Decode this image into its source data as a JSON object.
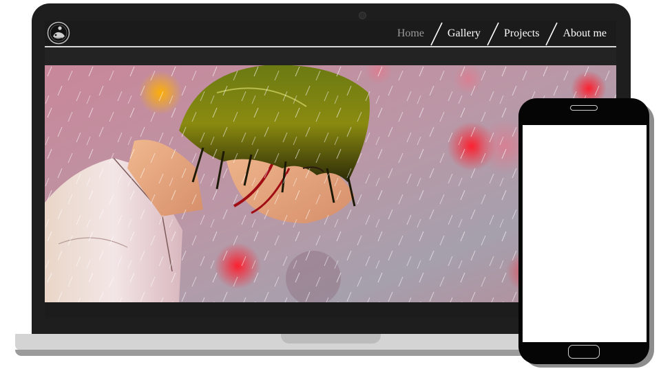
{
  "site": {
    "nav": [
      {
        "label": "Home",
        "active": true
      },
      {
        "label": "Gallery",
        "active": false
      },
      {
        "label": "Projects",
        "active": false
      },
      {
        "label": "About me",
        "active": false
      }
    ]
  },
  "icons": {
    "logo": "logo-icon",
    "camera": "camera-icon",
    "speaker": "speaker-icon",
    "home_button": "home-button-icon"
  },
  "colors": {
    "laptop_frame": "#1e1e1e",
    "nav_background": "#1b1b1b",
    "nav_text": "#ffffff",
    "nav_active_text": "#9a9a9a",
    "nav_underline": "#d9d9d9",
    "laptop_base": "#d4d4d4",
    "phone_body": "#050505",
    "phone_screen": "#ffffff"
  }
}
